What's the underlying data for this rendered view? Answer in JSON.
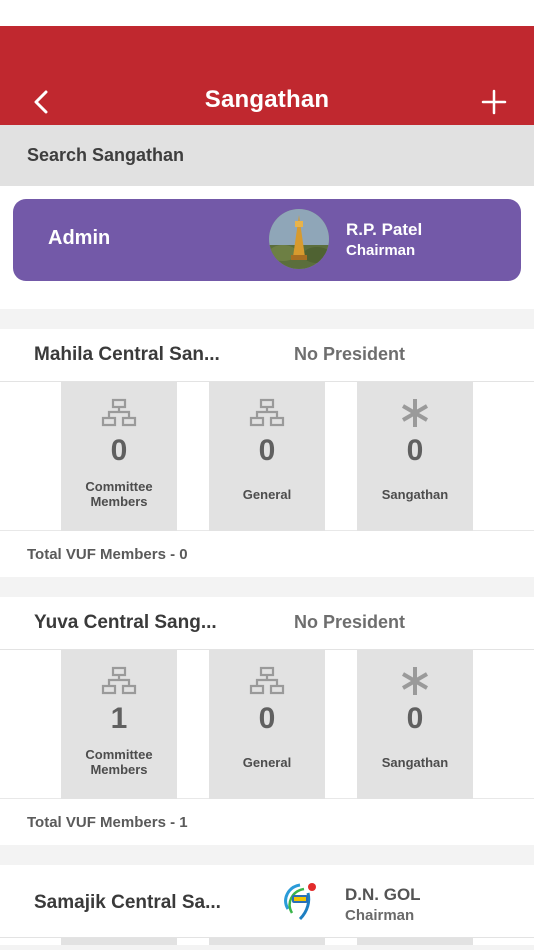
{
  "header": {
    "title": "Sangathan",
    "back_icon": "chevron-left-icon",
    "add_icon": "plus-icon",
    "color": "#c0282f"
  },
  "search": {
    "placeholder": "Search Sangathan"
  },
  "admin": {
    "label": "Admin",
    "name": "R.P. Patel",
    "role": "Chairman",
    "color": "#7359a8"
  },
  "sangathans": [
    {
      "name": "Mahila Central San...",
      "president": "No President",
      "stats": [
        {
          "count": "0",
          "label": "Committee Members",
          "icon": "network-icon"
        },
        {
          "count": "0",
          "label": "General",
          "icon": "network-icon"
        },
        {
          "count": "0",
          "label": "Sangathan",
          "icon": "asterisk-icon"
        }
      ],
      "total": "Total VUF Members - 0"
    },
    {
      "name": "Yuva Central Sang...",
      "president": "No President",
      "stats": [
        {
          "count": "1",
          "label": "Committee Members",
          "icon": "network-icon"
        },
        {
          "count": "0",
          "label": "General",
          "icon": "network-icon"
        },
        {
          "count": "0",
          "label": "Sangathan",
          "icon": "asterisk-icon"
        }
      ],
      "total": "Total VUF Members - 1"
    },
    {
      "name": "Samajik Central Sa...",
      "president_name": "D.N. GOL",
      "president_role": "Chairman"
    }
  ]
}
